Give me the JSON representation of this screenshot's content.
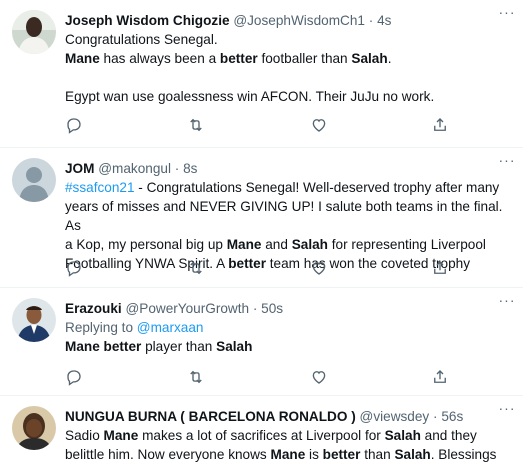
{
  "tweets": [
    {
      "name": "Joseph Wisdom Chigozie",
      "handle": "@JosephWisdomCh1",
      "dot": "·",
      "time": "4s",
      "lines": [
        "Congratulations Senegal.",
        "Mane has always been a better footballer than Salah.",
        "",
        "Egypt wan use goalessness win AFCON. Their JuJu no work."
      ]
    },
    {
      "name": "JOM",
      "handle": "@makongul",
      "dot": "·",
      "time": "8s",
      "hashtag": "#ssafcon21",
      "lines": [
        " - Congratulations Senegal! Well-deserved trophy after many",
        "years of misses and NEVER GIVING UP! I salute both teams in the final. As",
        "a Kop, my personal big up Mane and Salah for representing Liverpool",
        "Footballing YNWA Spirit. A better team has won the coveted trophy"
      ]
    },
    {
      "name": "Erazouki",
      "handle": "@PowerYourGrowth",
      "dot": "·",
      "time": "50s",
      "replying_label": "Replying to ",
      "replying_to": "@marxaan",
      "lines": [
        "Mane better player than Salah"
      ]
    },
    {
      "name": "NUNGUA BURNA ( BARCELONA RONALDO )",
      "handle": "@viewsdey",
      "dot": "·",
      "time": "56s",
      "lines": [
        "Sadio Mane makes a lot of sacrifices at Liverpool for Salah and they",
        "belittle him. Now everyone knows Mane is better than Salah. Blessings"
      ]
    }
  ],
  "more_glyph": "···",
  "colors": {
    "accent": "#1d9bf0",
    "secondary_text": "#536471",
    "divider": "#eff3f4"
  },
  "icons": [
    "reply-icon",
    "retweet-icon",
    "like-icon",
    "share-icon"
  ]
}
